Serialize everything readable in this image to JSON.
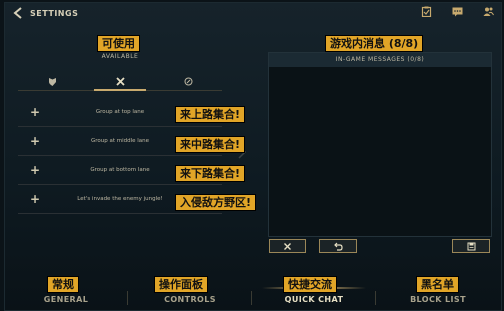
{
  "header": {
    "title": "SETTINGS",
    "icons": [
      "back-arrow-icon",
      "clipboard-icon",
      "chat-icon",
      "friends-icon"
    ]
  },
  "left_panel": {
    "annotation": "可使用",
    "subtitle": "AVAILABLE",
    "tabs": [
      {
        "icon": "shield-icon",
        "active": false
      },
      {
        "icon": "crossed-swords-icon",
        "active": true
      },
      {
        "icon": "ping-icon",
        "active": false
      }
    ],
    "messages": [
      {
        "text": "Group at top lane",
        "annotation": "来上路集合!"
      },
      {
        "text": "Group at middle lane",
        "annotation": "来中路集合!"
      },
      {
        "text": "Group at bottom lane",
        "annotation": "来下路集合!"
      },
      {
        "text": "Let's invade the enemy jungle!",
        "annotation": "入侵敌方野区!"
      }
    ]
  },
  "right_panel": {
    "annotation": "游戏内消息 (8/8)",
    "title": "IN-GAME MESSAGES (0/8)"
  },
  "buttons": {
    "clear_icon": "close-icon",
    "undo_icon": "undo-icon",
    "save_icon": "save-icon"
  },
  "bottom_nav": [
    {
      "label": "GENERAL",
      "annotation": "常规",
      "active": false
    },
    {
      "label": "CONTROLS",
      "annotation": "操作面板",
      "active": false
    },
    {
      "label": "QUICK CHAT",
      "annotation": "快捷交流",
      "active": true
    },
    {
      "label": "BLOCK LIST",
      "annotation": "黑名单",
      "active": false
    }
  ],
  "colors": {
    "accent_gold": "#c8aa6e",
    "annotation_bg": "#e1a527",
    "background": "#0b1318"
  }
}
